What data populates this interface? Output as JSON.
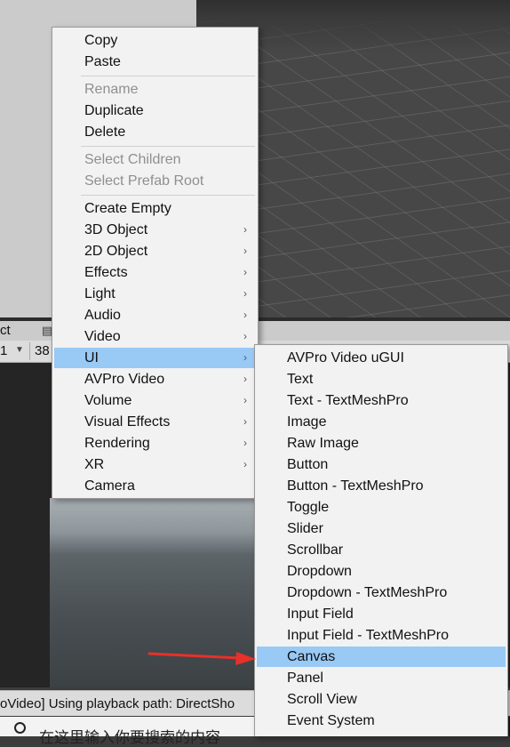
{
  "panels": {
    "tab_title": "ct",
    "toolbar_left": "1",
    "toolbar_right": "38",
    "console_log": "oVideo] Using playback path: DirectSho"
  },
  "taskbar": {
    "search_text": "在这里输入你要搜索的内容"
  },
  "context_menu": {
    "items": [
      {
        "label": "Copy",
        "enabled": true
      },
      {
        "label": "Paste",
        "enabled": true
      },
      {
        "label": "Rename",
        "enabled": false
      },
      {
        "label": "Duplicate",
        "enabled": true
      },
      {
        "label": "Delete",
        "enabled": true
      },
      {
        "label": "Select Children",
        "enabled": false
      },
      {
        "label": "Select Prefab Root",
        "enabled": false
      },
      {
        "label": "Create Empty",
        "enabled": true
      },
      {
        "label": "3D Object",
        "enabled": true,
        "submenu": true
      },
      {
        "label": "2D Object",
        "enabled": true,
        "submenu": true
      },
      {
        "label": "Effects",
        "enabled": true,
        "submenu": true
      },
      {
        "label": "Light",
        "enabled": true,
        "submenu": true
      },
      {
        "label": "Audio",
        "enabled": true,
        "submenu": true
      },
      {
        "label": "Video",
        "enabled": true,
        "submenu": true
      },
      {
        "label": "UI",
        "enabled": true,
        "submenu": true,
        "highlighted": true
      },
      {
        "label": "AVPro Video",
        "enabled": true,
        "submenu": true
      },
      {
        "label": "Volume",
        "enabled": true,
        "submenu": true
      },
      {
        "label": "Visual Effects",
        "enabled": true,
        "submenu": true
      },
      {
        "label": "Rendering",
        "enabled": true,
        "submenu": true
      },
      {
        "label": "XR",
        "enabled": true,
        "submenu": true
      },
      {
        "label": "Camera",
        "enabled": true
      }
    ],
    "submenu_arrow": "›"
  },
  "ui_submenu": {
    "items": [
      {
        "label": "AVPro Video uGUI"
      },
      {
        "label": "Text"
      },
      {
        "label": "Text - TextMeshPro"
      },
      {
        "label": "Image"
      },
      {
        "label": "Raw Image"
      },
      {
        "label": "Button"
      },
      {
        "label": "Button - TextMeshPro"
      },
      {
        "label": "Toggle"
      },
      {
        "label": "Slider"
      },
      {
        "label": "Scrollbar"
      },
      {
        "label": "Dropdown"
      },
      {
        "label": "Dropdown - TextMeshPro"
      },
      {
        "label": "Input Field"
      },
      {
        "label": "Input Field - TextMeshPro"
      },
      {
        "label": "Canvas",
        "highlighted": true
      },
      {
        "label": "Panel"
      },
      {
        "label": "Scroll View"
      },
      {
        "label": "Event System"
      }
    ]
  },
  "colors": {
    "highlight": "#99c9f5",
    "menu_bg": "#f2f2f2",
    "annotation_arrow": "#e8302a"
  }
}
